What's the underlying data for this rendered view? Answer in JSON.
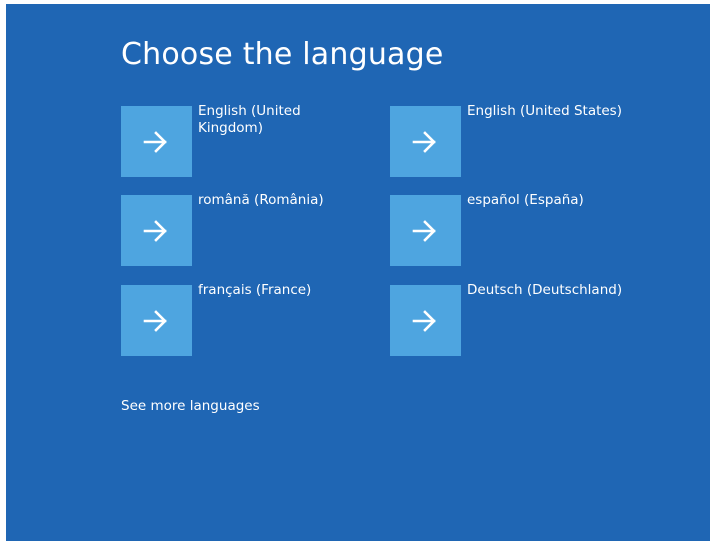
{
  "page": {
    "title": "Choose the language",
    "more_link": "See more languages"
  },
  "languages": [
    {
      "label": "English (United Kingdom)"
    },
    {
      "label": "English (United States)"
    },
    {
      "label": "română (România)"
    },
    {
      "label": "español (España)"
    },
    {
      "label": "français (France)"
    },
    {
      "label": "Deutsch (Deutschland)"
    }
  ],
  "icons": {
    "tile_icon": "arrow-right-icon"
  },
  "colors": {
    "background": "#1f66b4",
    "tile": "#4ea5e0",
    "text": "#ffffff"
  }
}
